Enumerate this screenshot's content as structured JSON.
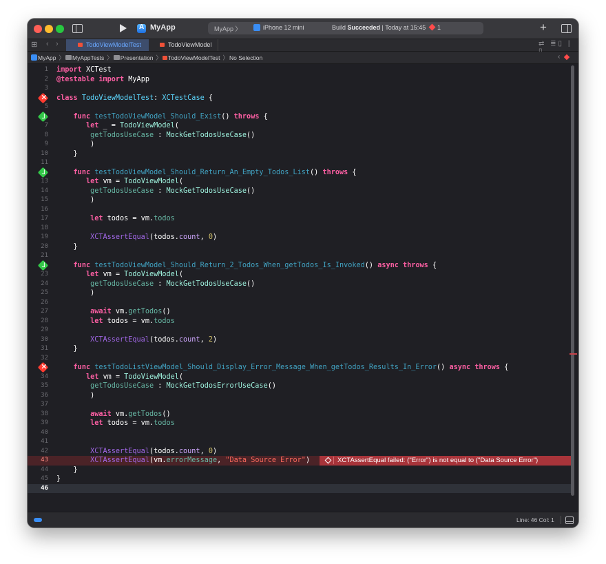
{
  "toolbar": {
    "app_name": "MyApp",
    "scheme_target": "MyApp 〉",
    "device_name": "iPhone 12 mini",
    "build_prefix": "Build ",
    "build_result": "Succeeded",
    "build_time": " | Today at 15:45",
    "error_count": "1",
    "plus_label": "+"
  },
  "tabs": [
    {
      "label": "TodoViewModelTest",
      "active": true
    },
    {
      "label": "TodoViewModel",
      "active": false
    }
  ],
  "tabbar_right": "⇄ ≣▯ | ▯",
  "breadcrumb": {
    "project": "MyApp",
    "folder1": "MyAppTests",
    "folder2": "Presentation",
    "file": "TodoViewModelTest",
    "symbol": "No Selection"
  },
  "editor": {
    "error_message": "XCTAssertEqual failed: (\"Error\") is not equal to (\"Data Source Error\")",
    "current_line": 46,
    "error_line": 43
  },
  "status": {
    "cursor": "Line: 46  Col: 1"
  },
  "colors": {
    "editor_bg": "#1f1f24",
    "keyword": "#fc5fa3",
    "type": "#5dd8ff",
    "pass": "#33c748",
    "fail": "#ff3b30"
  }
}
